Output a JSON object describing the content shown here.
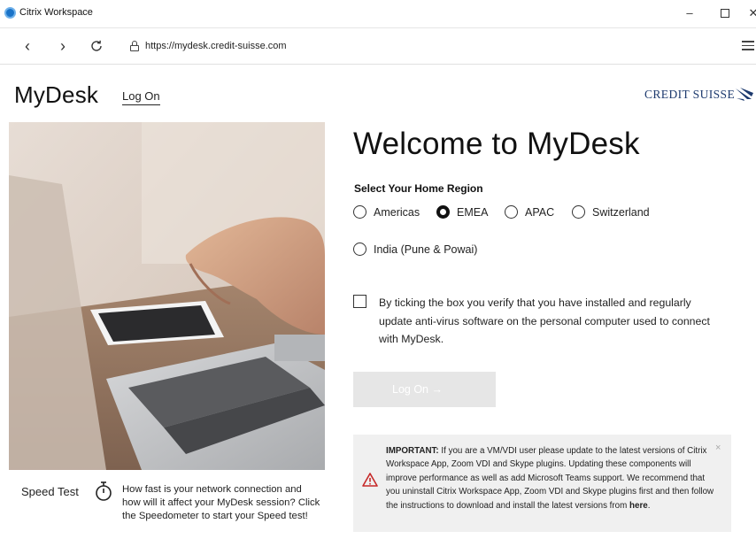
{
  "window": {
    "title": "Citrix Workspace",
    "controls": {
      "minimize": "–",
      "close": "✕"
    }
  },
  "navbar": {
    "back": "‹",
    "forward": "›",
    "reload": "C",
    "url": "https://mydesk.credit-suisse.com"
  },
  "header": {
    "brand": "MyDesk",
    "logon_link": "Log On",
    "logo_text": "CREDIT SUISSE"
  },
  "main": {
    "welcome": "Welcome to MyDesk",
    "region_heading": "Select Your Home Region",
    "regions": [
      {
        "label": "Americas",
        "checked": false
      },
      {
        "label": "EMEA",
        "checked": true
      },
      {
        "label": "APAC",
        "checked": false
      },
      {
        "label": "Switzerland",
        "checked": false
      },
      {
        "label": "India (Pune & Powai)",
        "checked": false
      }
    ],
    "consent_text": "By ticking the box you verify that you have installed and regularly update anti-virus software on the personal computer used to connect with MyDesk.",
    "consent_checked": false,
    "logon_button": "Log On →"
  },
  "notice": {
    "important_label": "IMPORTANT:",
    "body": " If you are a VM/VDI user please update to the latest versions of Citrix Workspace App, Zoom VDI and Skype plugins. Updating these components will improve performance as well as add Microsoft Teams support. We recommend that you uninstall Citrix Workspace App, Zoom VDI and Skype plugins first and then follow the instructions to download and install the latest versions from ",
    "link": "here",
    "end": ".",
    "close": "×"
  },
  "speed_test": {
    "label": "Speed Test",
    "text": "How fast is your network connection and how will it affect your MyDesk session? Click the Speedometer to start your Speed test!"
  },
  "colors": {
    "brand_navy": "#1d3a6e",
    "button_disabled": "#e6e6e6",
    "notice_bg": "#f0f0f0",
    "warning_red": "#c62828"
  }
}
